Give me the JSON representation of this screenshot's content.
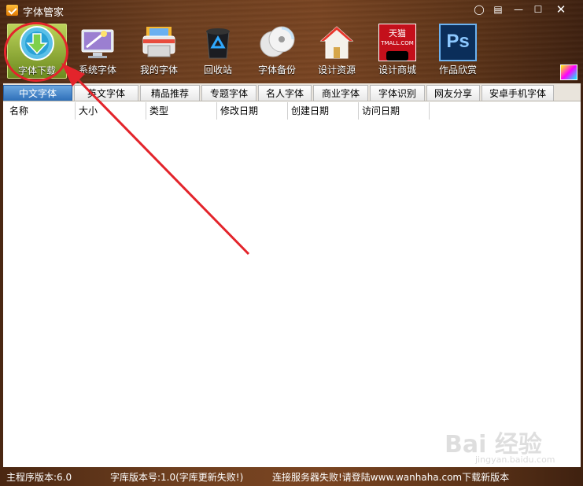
{
  "window": {
    "title": "字体管家"
  },
  "toolbar": {
    "items": [
      {
        "label": "字体下载",
        "icon": "download-globe-icon"
      },
      {
        "label": "系统字体",
        "icon": "monitor-magic-icon"
      },
      {
        "label": "我的字体",
        "icon": "printer-folder-icon"
      },
      {
        "label": "回收站",
        "icon": "recycle-bin-icon"
      },
      {
        "label": "字体备份",
        "icon": "discs-backup-icon"
      },
      {
        "label": "设计资源",
        "icon": "house-icon"
      },
      {
        "label": "设计商城",
        "icon": "tmall-logo-icon"
      },
      {
        "label": "作品欣赏",
        "icon": "photoshop-icon"
      }
    ],
    "tmall_text": "天猫",
    "tmall_sub": "TMALL.COM",
    "ps_text": "Ps"
  },
  "tabs": [
    "中文字体",
    "英文字体",
    "精品推荐",
    "专题字体",
    "名人字体",
    "商业字体",
    "字体识别",
    "网友分享",
    "安卓手机字体"
  ],
  "table": {
    "columns": [
      "名称",
      "大小",
      "类型",
      "修改日期",
      "创建日期",
      "访问日期"
    ]
  },
  "status": {
    "program_version": "主程序版本:6.0",
    "library_version": "字库版本号:1.0(字库更新失败!)",
    "message": "连接服务器失败!请登陆www.wanhaha.com下载新版本"
  },
  "watermark": {
    "text": "Bai 经验",
    "sub": "jingyan.baidu.com"
  },
  "colors": {
    "accent_red": "#e3242b",
    "tab_active": "#3a7cc4",
    "wood": "#6e3f1f"
  }
}
